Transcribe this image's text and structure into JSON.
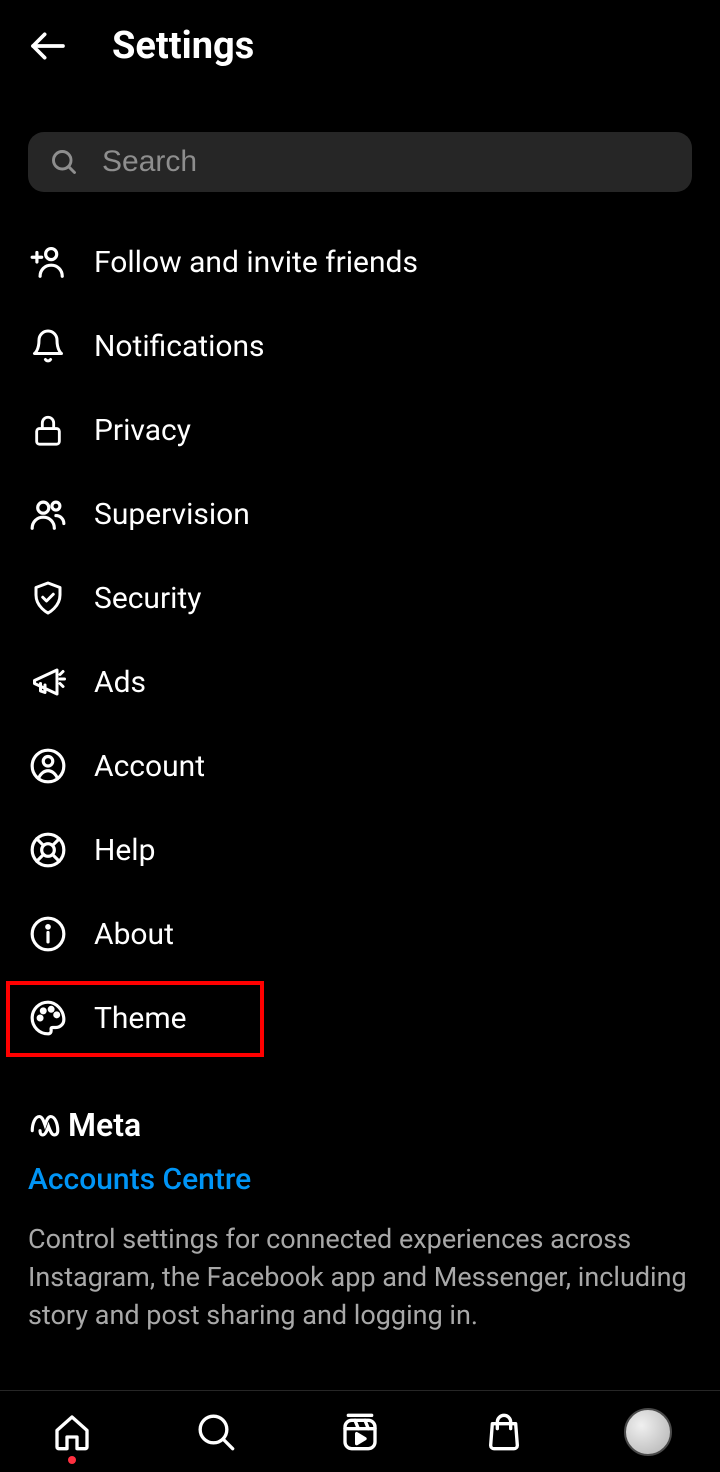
{
  "header": {
    "title": "Settings"
  },
  "search": {
    "placeholder": "Search"
  },
  "menu": {
    "items": [
      {
        "label": "Follow and invite friends",
        "icon": "person-add"
      },
      {
        "label": "Notifications",
        "icon": "bell"
      },
      {
        "label": "Privacy",
        "icon": "lock"
      },
      {
        "label": "Supervision",
        "icon": "people"
      },
      {
        "label": "Security",
        "icon": "shield-check"
      },
      {
        "label": "Ads",
        "icon": "megaphone"
      },
      {
        "label": "Account",
        "icon": "user-circle"
      },
      {
        "label": "Help",
        "icon": "life-ring"
      },
      {
        "label": "About",
        "icon": "info"
      },
      {
        "label": "Theme",
        "icon": "palette"
      }
    ]
  },
  "meta": {
    "brand": "Meta",
    "link": "Accounts Centre",
    "description": "Control settings for connected experiences across Instagram, the Facebook app and Messenger, including story and post sharing and logging in."
  },
  "highlight": {
    "target": "Theme"
  }
}
